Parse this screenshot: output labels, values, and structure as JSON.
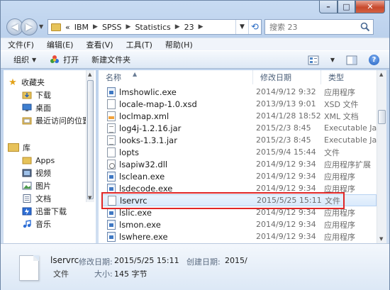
{
  "address": {
    "prefix": "«",
    "crumbs": [
      "IBM",
      "SPSS",
      "Statistics",
      "23"
    ]
  },
  "search": {
    "placeholder": "搜索 23"
  },
  "menu": [
    "文件(F)",
    "编辑(E)",
    "查看(V)",
    "工具(T)",
    "帮助(H)"
  ],
  "toolbar": {
    "organize": "组织",
    "open": "打开",
    "new_folder": "新建文件夹"
  },
  "nav": {
    "favorites": "收藏夹",
    "downloads": "下载",
    "desktop": "桌面",
    "recent": "最近访问的位置",
    "libraries": "库",
    "apps": "Apps",
    "videos": "视频",
    "pictures": "图片",
    "documents": "文档",
    "thunder": "迅雷下载",
    "music": "音乐"
  },
  "columns": {
    "name": "名称",
    "date": "修改日期",
    "type": "类型"
  },
  "files": [
    {
      "name": "lmshowlic.exe",
      "date": "2014/9/12 9:32",
      "type": "应用程序",
      "icon": "exe"
    },
    {
      "name": "locale-map-1.0.xsd",
      "date": "2013/9/13 9:01",
      "type": "XSD 文件",
      "icon": "file"
    },
    {
      "name": "loclmap.xml",
      "date": "2014/1/28 18:52",
      "type": "XML 文档",
      "icon": "xml"
    },
    {
      "name": "log4j-1.2.16.jar",
      "date": "2015/2/3 8:45",
      "type": "Executable Jar",
      "icon": "jar"
    },
    {
      "name": "looks-1.3.1.jar",
      "date": "2015/2/3 8:45",
      "type": "Executable Jar",
      "icon": "jar"
    },
    {
      "name": "lopts",
      "date": "2015/9/4 15:44",
      "type": "文件",
      "icon": "file"
    },
    {
      "name": "lsapiw32.dll",
      "date": "2014/9/12 9:34",
      "type": "应用程序扩展",
      "icon": "dll"
    },
    {
      "name": "lsclean.exe",
      "date": "2014/9/12 9:34",
      "type": "应用程序",
      "icon": "exe"
    },
    {
      "name": "lsdecode.exe",
      "date": "2014/9/12 9:34",
      "type": "应用程序",
      "icon": "exe"
    },
    {
      "name": "lservrc",
      "date": "2015/5/25 15:11",
      "type": "文件",
      "icon": "file",
      "selected": true
    },
    {
      "name": "lslic.exe",
      "date": "2014/9/12 9:34",
      "type": "应用程序",
      "icon": "exe"
    },
    {
      "name": "lsmon.exe",
      "date": "2014/9/12 9:34",
      "type": "应用程序",
      "icon": "exe"
    },
    {
      "name": "lswhere.exe",
      "date": "2014/9/12 9:34",
      "type": "应用程序",
      "icon": "exe"
    }
  ],
  "details": {
    "name": "lservrc",
    "type": "文件",
    "modified_label": "修改日期:",
    "modified_value": "2015/5/25 15:11",
    "size_label": "大小:",
    "size_value": "145 字节",
    "created_label": "创建日期:",
    "created_value": "2015/"
  },
  "colors": {
    "highlight": "#e02626",
    "selection": "#d9eafc"
  }
}
